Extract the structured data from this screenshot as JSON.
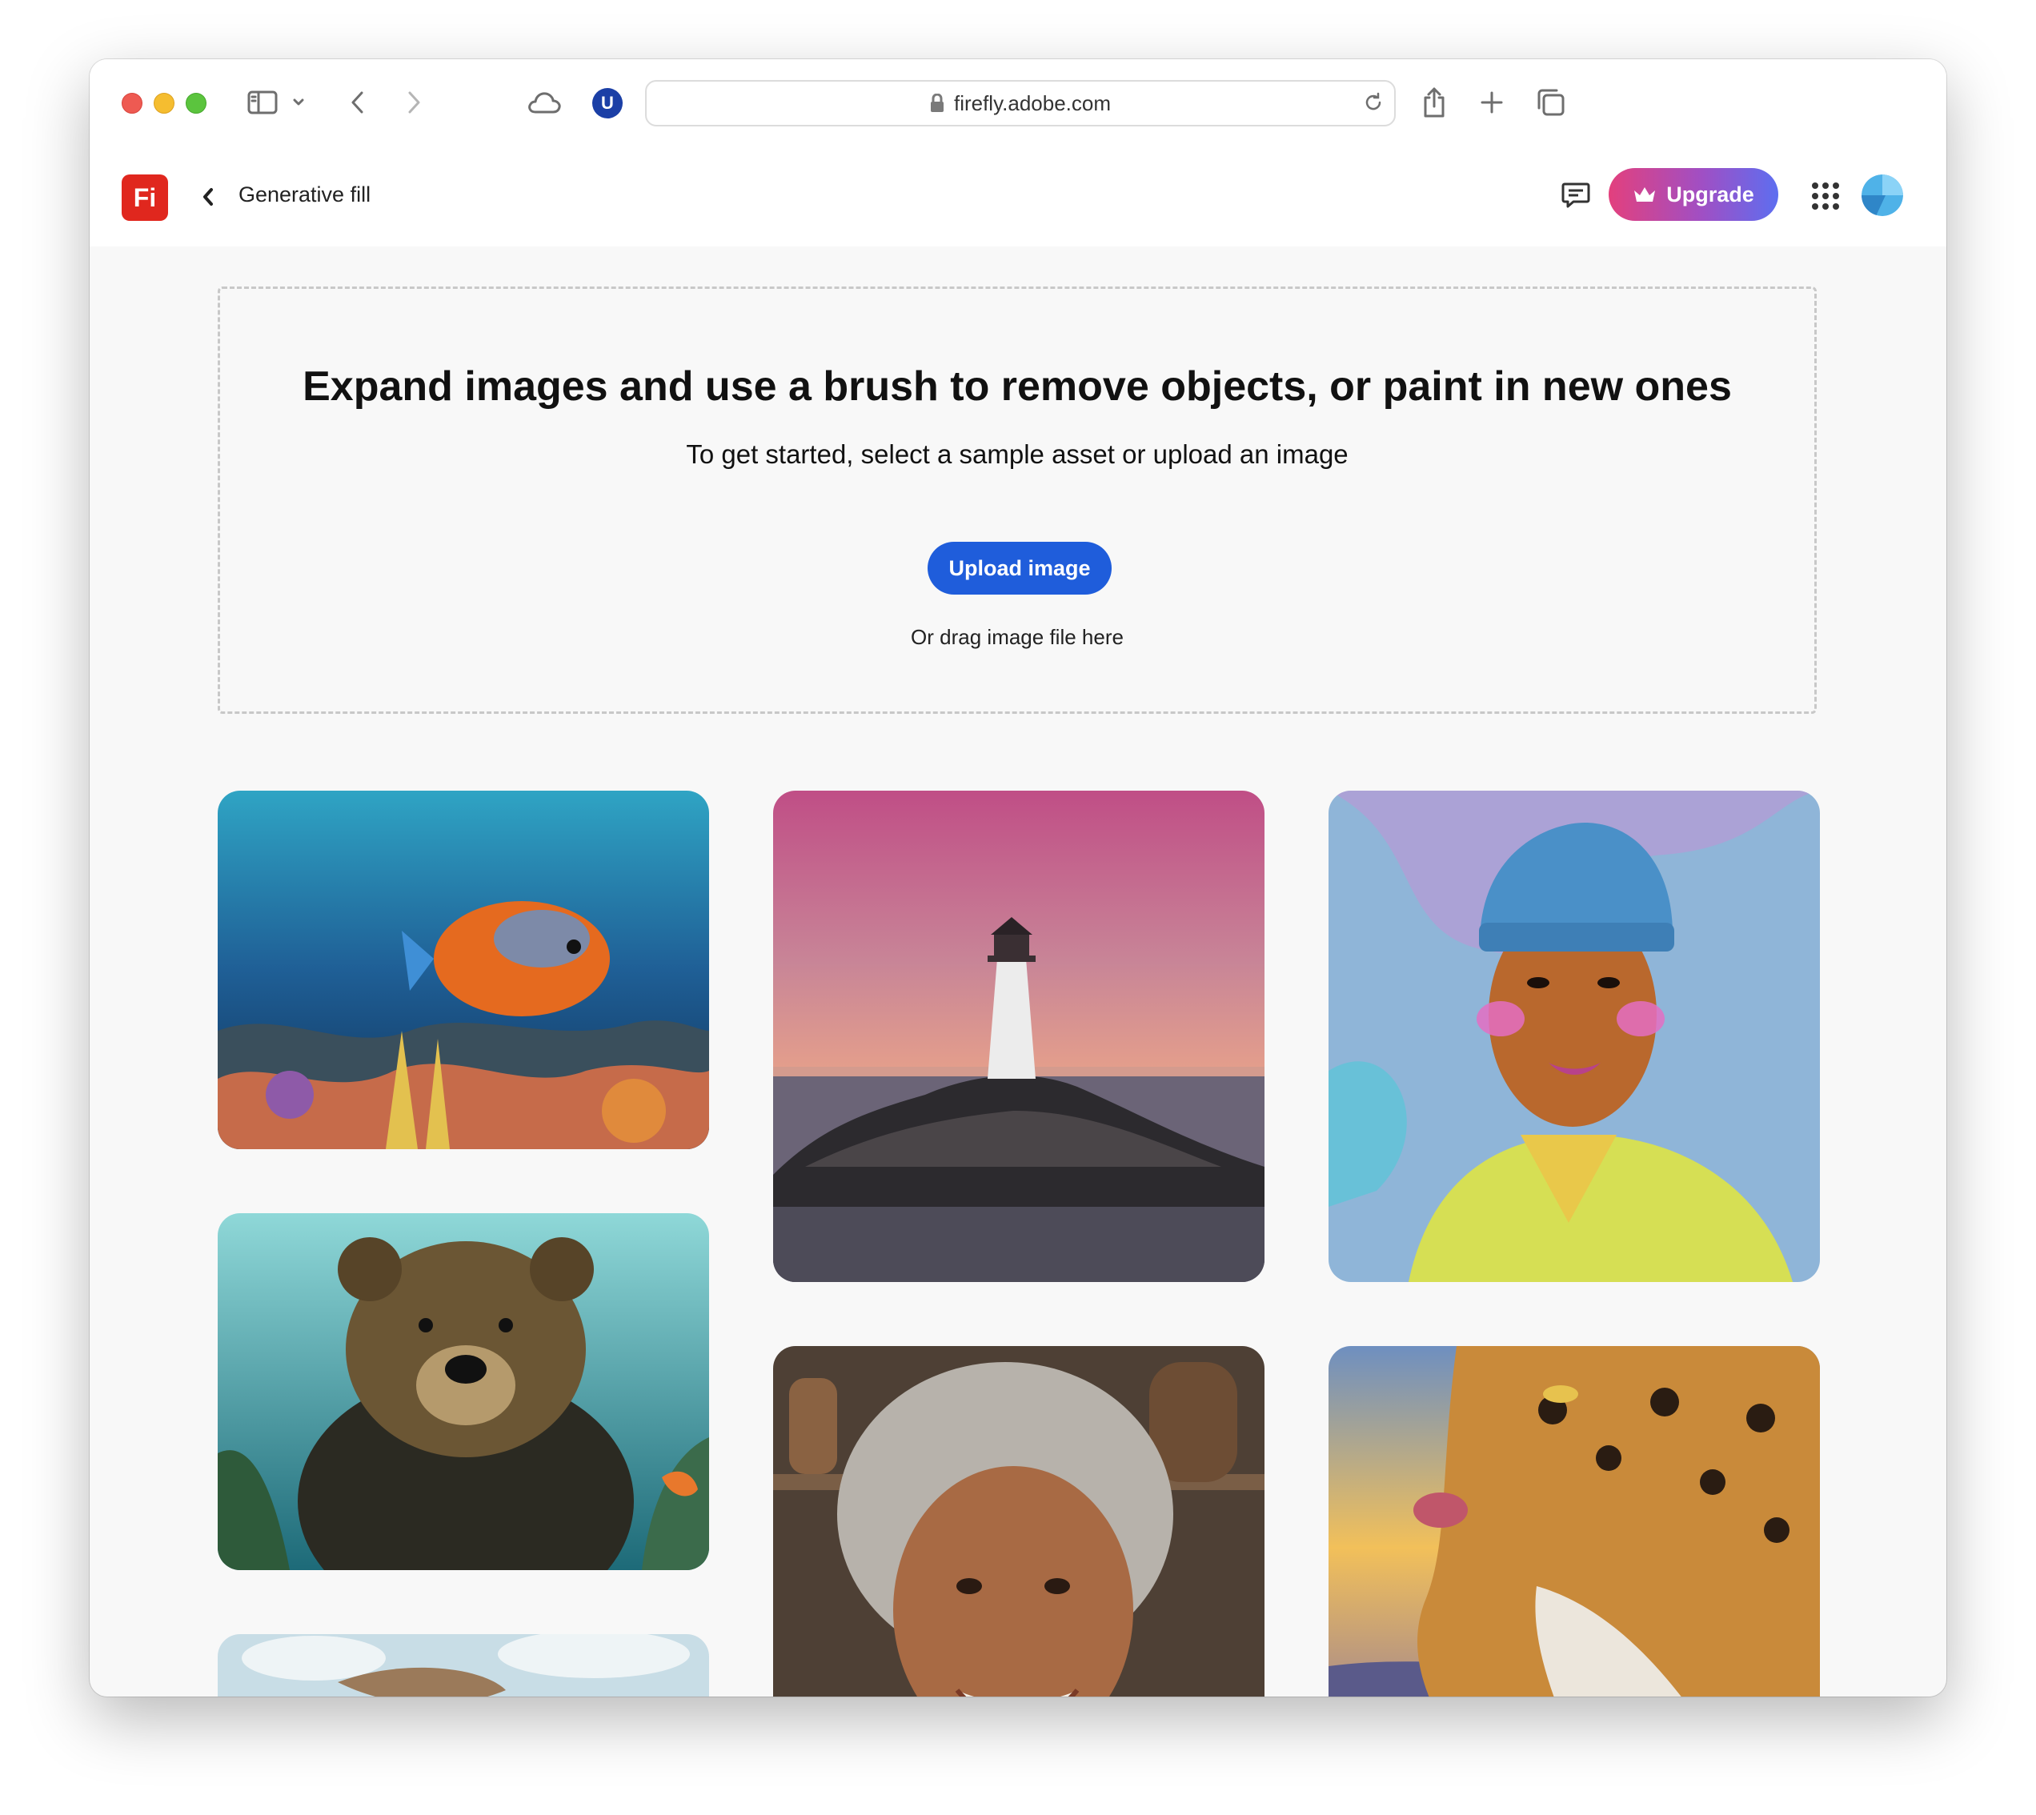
{
  "browser": {
    "url": "firefly.adobe.com",
    "extension_badge": "U"
  },
  "app": {
    "logo_text": "Fi",
    "page_name": "Generative fill",
    "upgrade_label": "Upgrade",
    "brand_color": "#e0271e",
    "accent_color": "#1f5ddb"
  },
  "dropzone": {
    "title": "Expand images and use a brush to remove objects, or paint in new ones",
    "subtitle": "To get started, select a sample asset or upload an image",
    "upload_label": "Upload image",
    "drag_hint": "Or drag image file here"
  },
  "samples": [
    {
      "subject": "underwater fish and coral reef"
    },
    {
      "subject": "lighthouse on rocky island at sunset"
    },
    {
      "subject": "illustrated portrait of young man in blue beanie"
    },
    {
      "subject": "bear swimming underwater"
    },
    {
      "subject": "smiling elderly woman portrait"
    },
    {
      "subject": "leopard illustration at sunset"
    },
    {
      "subject": "boat on water under cloudy sky"
    }
  ]
}
